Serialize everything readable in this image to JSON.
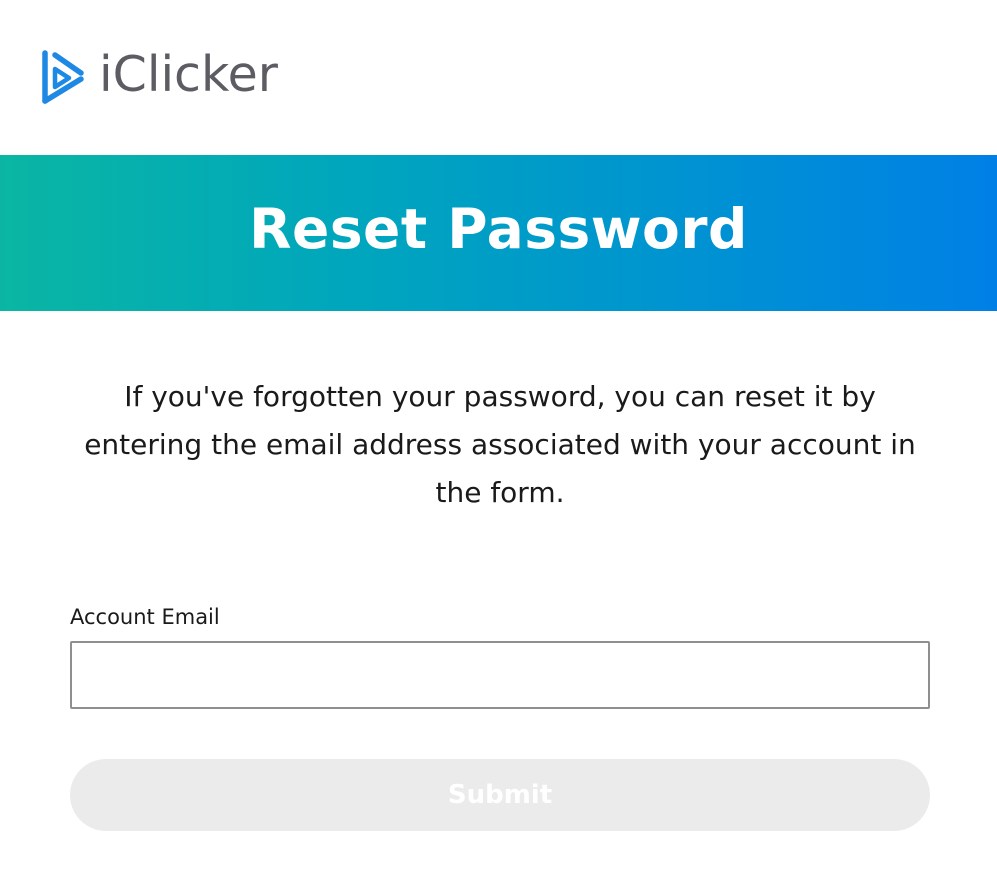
{
  "brand": {
    "name": "iClicker",
    "icon": "iclicker-logo-icon",
    "color": "#5c5c63",
    "mark_color": "#1e88e5"
  },
  "banner": {
    "title": "Reset Password",
    "gradient_start": "#0ab6a3",
    "gradient_end": "#0080e6"
  },
  "intro": {
    "text": "If you've forgotten your password, you can reset it by entering the email address associated with your account in the form."
  },
  "form": {
    "email_label": "Account Email",
    "email_value": "",
    "email_placeholder": "",
    "submit_label": "Submit",
    "submit_state": "disabled"
  }
}
